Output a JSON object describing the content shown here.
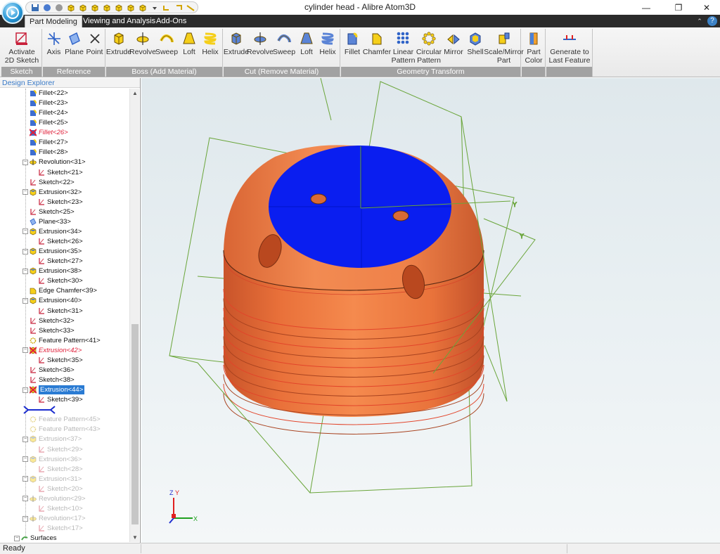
{
  "window": {
    "title": "cylinder head - Alibre Atom3D",
    "minimize_glyph": "—",
    "restore_glyph": "❐",
    "close_glyph": "✕"
  },
  "quick_access": [
    "save-icon",
    "new-icon",
    "open-icon",
    "view-iso-icon",
    "view-front-icon",
    "view-back-icon",
    "view-left-icon",
    "view-right-icon",
    "view-top-icon",
    "view-bottom-icon",
    "dropdown-icon",
    "undo-icon",
    "redo-icon",
    "measure-icon"
  ],
  "tabs": [
    {
      "label": "Part Modeling",
      "active": true
    },
    {
      "label": "Viewing and Analysis",
      "active": false
    },
    {
      "label": "Add-Ons",
      "active": false
    }
  ],
  "ribbon": {
    "groups": [
      {
        "label": "Sketch",
        "buttons": [
          {
            "label1": "Activate",
            "label2": "2D Sketch ▾",
            "icon": "sketch-icon"
          }
        ]
      },
      {
        "label": "Reference",
        "buttons": [
          {
            "label1": "Axis",
            "label2": "",
            "icon": "axis-icon"
          },
          {
            "label1": "Plane",
            "label2": "",
            "icon": "plane-icon"
          },
          {
            "label1": "Point",
            "label2": "",
            "icon": "point-icon"
          }
        ]
      },
      {
        "label": "Boss (Add Material)",
        "buttons": [
          {
            "label1": "Extrude",
            "label2": "",
            "icon": "extrude-boss-icon"
          },
          {
            "label1": "Revolve",
            "label2": "",
            "icon": "revolve-boss-icon"
          },
          {
            "label1": "Sweep",
            "label2": "",
            "icon": "sweep-boss-icon"
          },
          {
            "label1": "Loft",
            "label2": "",
            "icon": "loft-boss-icon"
          },
          {
            "label1": "Helix",
            "label2": "",
            "icon": "helix-boss-icon"
          }
        ]
      },
      {
        "label": "Cut (Remove Material)",
        "buttons": [
          {
            "label1": "Extrude",
            "label2": "",
            "icon": "extrude-cut-icon"
          },
          {
            "label1": "Revolve",
            "label2": "",
            "icon": "revolve-cut-icon"
          },
          {
            "label1": "Sweep",
            "label2": "",
            "icon": "sweep-cut-icon"
          },
          {
            "label1": "Loft",
            "label2": "",
            "icon": "loft-cut-icon"
          },
          {
            "label1": "Helix",
            "label2": "",
            "icon": "helix-cut-icon"
          }
        ]
      },
      {
        "label": "Geometry Transform",
        "buttons": [
          {
            "label1": "Fillet",
            "label2": "",
            "icon": "fillet-icon"
          },
          {
            "label1": "Chamfer",
            "label2": "",
            "icon": "chamfer-icon"
          },
          {
            "label1": "Linear",
            "label2": "Pattern",
            "icon": "linear-pattern-icon"
          },
          {
            "label1": "Circular",
            "label2": "Pattern",
            "icon": "circular-pattern-icon"
          },
          {
            "label1": "Mirror",
            "label2": "",
            "icon": "mirror-icon"
          },
          {
            "label1": "Shell",
            "label2": "",
            "icon": "shell-icon"
          },
          {
            "label1": "Scale/Mirror",
            "label2": "Part",
            "icon": "scale-mirror-icon"
          }
        ]
      },
      {
        "label": "",
        "buttons": [
          {
            "label1": "Part",
            "label2": "Color",
            "icon": "part-color-icon"
          }
        ]
      },
      {
        "label": "",
        "buttons": [
          {
            "label1": "Generate to",
            "label2": "Last Feature ▾",
            "icon": "generate-icon"
          }
        ]
      }
    ]
  },
  "explorer": {
    "title": "Design Explorer",
    "items": [
      {
        "label": "Fillet<22>",
        "level": 1,
        "icon": "fillet",
        "state": "normal"
      },
      {
        "label": "Fillet<23>",
        "level": 1,
        "icon": "fillet",
        "state": "normal"
      },
      {
        "label": "Fillet<24>",
        "level": 1,
        "icon": "fillet",
        "state": "normal"
      },
      {
        "label": "Fillet<25>",
        "level": 1,
        "icon": "fillet",
        "state": "normal"
      },
      {
        "label": "Fillet<26>",
        "level": 1,
        "icon": "fillet-failed",
        "state": "failed"
      },
      {
        "label": "Fillet<27>",
        "level": 1,
        "icon": "fillet",
        "state": "normal"
      },
      {
        "label": "Fillet<28>",
        "level": 1,
        "icon": "fillet",
        "state": "normal"
      },
      {
        "label": "Revolution<31>",
        "level": 1,
        "icon": "revolve",
        "state": "normal",
        "expander": true
      },
      {
        "label": "Sketch<21>",
        "level": 2,
        "icon": "sketch",
        "state": "normal"
      },
      {
        "label": "Sketch<22>",
        "level": 1,
        "icon": "sketch",
        "state": "normal"
      },
      {
        "label": "Extrusion<32>",
        "level": 1,
        "icon": "extrude",
        "state": "normal",
        "expander": true
      },
      {
        "label": "Sketch<23>",
        "level": 2,
        "icon": "sketch",
        "state": "normal"
      },
      {
        "label": "Sketch<25>",
        "level": 1,
        "icon": "sketch",
        "state": "normal"
      },
      {
        "label": "Plane<33>",
        "level": 1,
        "icon": "plane",
        "state": "normal"
      },
      {
        "label": "Extrusion<34>",
        "level": 1,
        "icon": "extrude",
        "state": "normal",
        "expander": true
      },
      {
        "label": "Sketch<26>",
        "level": 2,
        "icon": "sketch",
        "state": "normal"
      },
      {
        "label": "Extrusion<35>",
        "level": 1,
        "icon": "extrude",
        "state": "normal",
        "expander": true
      },
      {
        "label": "Sketch<27>",
        "level": 2,
        "icon": "sketch",
        "state": "normal"
      },
      {
        "label": "Extrusion<38>",
        "level": 1,
        "icon": "extrude",
        "state": "normal",
        "expander": true
      },
      {
        "label": "Sketch<30>",
        "level": 2,
        "icon": "sketch",
        "state": "normal"
      },
      {
        "label": "Edge Chamfer<39>",
        "level": 1,
        "icon": "chamfer",
        "state": "normal"
      },
      {
        "label": "Extrusion<40>",
        "level": 1,
        "icon": "extrude",
        "state": "normal",
        "expander": true
      },
      {
        "label": "Sketch<31>",
        "level": 2,
        "icon": "sketch",
        "state": "normal"
      },
      {
        "label": "Sketch<32>",
        "level": 1,
        "icon": "sketch",
        "state": "normal"
      },
      {
        "label": "Sketch<33>",
        "level": 1,
        "icon": "sketch",
        "state": "normal"
      },
      {
        "label": "Feature Pattern<41>",
        "level": 1,
        "icon": "pattern",
        "state": "normal"
      },
      {
        "label": "Extrusion<42>",
        "level": 1,
        "icon": "extrude-failed",
        "state": "failed",
        "expander": true
      },
      {
        "label": "Sketch<35>",
        "level": 2,
        "icon": "sketch",
        "state": "normal"
      },
      {
        "label": "Sketch<36>",
        "level": 1,
        "icon": "sketch",
        "state": "normal"
      },
      {
        "label": "Sketch<38>",
        "level": 1,
        "icon": "sketch",
        "state": "normal"
      },
      {
        "label": "Extrusion<44>",
        "level": 1,
        "icon": "extrude-failed",
        "state": "selected",
        "expander": true
      },
      {
        "label": "Sketch<39>",
        "level": 2,
        "icon": "sketch",
        "state": "normal"
      },
      {
        "label": "",
        "level": 0,
        "icon": "rollback",
        "state": "rollback"
      },
      {
        "label": "Feature Pattern<45>",
        "level": 1,
        "icon": "pattern",
        "state": "suppressed"
      },
      {
        "label": "Feature Pattern<43>",
        "level": 1,
        "icon": "pattern",
        "state": "suppressed"
      },
      {
        "label": "Extrusion<37>",
        "level": 1,
        "icon": "extrude",
        "state": "suppressed",
        "expander": true
      },
      {
        "label": "Sketch<29>",
        "level": 2,
        "icon": "sketch",
        "state": "suppressed"
      },
      {
        "label": "Extrusion<36>",
        "level": 1,
        "icon": "extrude",
        "state": "suppressed",
        "expander": true
      },
      {
        "label": "Sketch<28>",
        "level": 2,
        "icon": "sketch",
        "state": "suppressed"
      },
      {
        "label": "Extrusion<31>",
        "level": 1,
        "icon": "extrude",
        "state": "suppressed",
        "expander": true
      },
      {
        "label": "Sketch<20>",
        "level": 2,
        "icon": "sketch",
        "state": "suppressed"
      },
      {
        "label": "Revolution<29>",
        "level": 1,
        "icon": "revolve",
        "state": "suppressed",
        "expander": true
      },
      {
        "label": "Sketch<10>",
        "level": 2,
        "icon": "sketch",
        "state": "suppressed"
      },
      {
        "label": "Revolution<17>",
        "level": 1,
        "icon": "revolve",
        "state": "suppressed",
        "expander": true
      },
      {
        "label": "Sketch<17>",
        "level": 2,
        "icon": "sketch",
        "state": "suppressed"
      },
      {
        "label": "Surfaces",
        "level": 0,
        "icon": "surfaces",
        "state": "normal",
        "expander": true
      }
    ]
  },
  "viewport": {
    "axis_labels": {
      "x": "X",
      "y": "Y",
      "z": "Z"
    },
    "colors": {
      "body": "#f07b3c",
      "top_face": "#0a1ef0",
      "reference": "#6aa53a"
    }
  },
  "status": {
    "text": "Ready"
  }
}
